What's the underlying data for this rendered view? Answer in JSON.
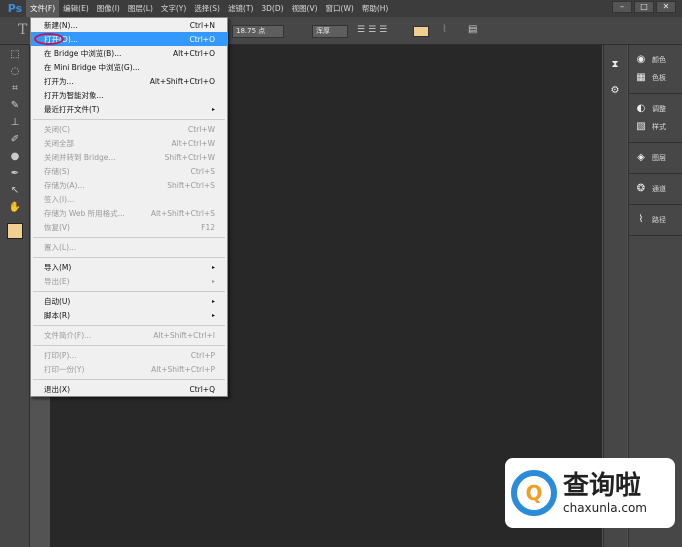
{
  "app": {
    "logo": "Ps"
  },
  "menubar": [
    "文件(F)",
    "编辑(E)",
    "图像(I)",
    "图层(L)",
    "文字(Y)",
    "选择(S)",
    "滤镜(T)",
    "3D(D)",
    "视图(V)",
    "窗口(W)",
    "帮助(H)"
  ],
  "window_buttons": [
    "–",
    "□",
    "✕"
  ],
  "options": {
    "tool_glyph": "T",
    "font_size": "18.75 点",
    "aa": "浑厚",
    "swatch_color": "#f0d090"
  },
  "file_menu": [
    {
      "label": "新建(N)...",
      "shortcut": "Ctrl+N"
    },
    {
      "label": "打开(O)...",
      "shortcut": "Ctrl+O",
      "highlight": true
    },
    {
      "label": "在 Bridge 中浏览(B)...",
      "shortcut": "Alt+Ctrl+O"
    },
    {
      "label": "在 Mini Bridge 中浏览(G)...",
      "shortcut": ""
    },
    {
      "label": "打开为...",
      "shortcut": "Alt+Shift+Ctrl+O"
    },
    {
      "label": "打开为智能对象...",
      "shortcut": ""
    },
    {
      "label": "最近打开文件(T)",
      "shortcut": "",
      "submenu": true
    },
    {
      "sep": true
    },
    {
      "label": "关闭(C)",
      "shortcut": "Ctrl+W",
      "disabled": true
    },
    {
      "label": "关闭全部",
      "shortcut": "Alt+Ctrl+W",
      "disabled": true
    },
    {
      "label": "关闭并转到 Bridge...",
      "shortcut": "Shift+Ctrl+W",
      "disabled": true
    },
    {
      "label": "存储(S)",
      "shortcut": "Ctrl+S",
      "disabled": true
    },
    {
      "label": "存储为(A)...",
      "shortcut": "Shift+Ctrl+S",
      "disabled": true
    },
    {
      "label": "签入(I)...",
      "shortcut": "",
      "disabled": true
    },
    {
      "label": "存储为 Web 所用格式...",
      "shortcut": "Alt+Shift+Ctrl+S",
      "disabled": true
    },
    {
      "label": "恢复(V)",
      "shortcut": "F12",
      "disabled": true
    },
    {
      "sep": true
    },
    {
      "label": "置入(L)...",
      "shortcut": "",
      "disabled": true
    },
    {
      "sep": true
    },
    {
      "label": "导入(M)",
      "shortcut": "",
      "submenu": true
    },
    {
      "label": "导出(E)",
      "shortcut": "",
      "submenu": true,
      "disabled": true
    },
    {
      "sep": true
    },
    {
      "label": "自动(U)",
      "shortcut": "",
      "submenu": true
    },
    {
      "label": "脚本(R)",
      "shortcut": "",
      "submenu": true
    },
    {
      "sep": true
    },
    {
      "label": "文件简介(F)...",
      "shortcut": "Alt+Shift+Ctrl+I",
      "disabled": true
    },
    {
      "sep": true
    },
    {
      "label": "打印(P)...",
      "shortcut": "Ctrl+P",
      "disabled": true
    },
    {
      "label": "打印一份(Y)",
      "shortcut": "Alt+Shift+Ctrl+P",
      "disabled": true
    },
    {
      "sep": true
    },
    {
      "label": "退出(X)",
      "shortcut": "Ctrl+Q"
    }
  ],
  "panels": [
    {
      "group": [
        {
          "icon": "color-icon",
          "glyph": "◉",
          "label": "颜色"
        },
        {
          "icon": "swatches-icon",
          "glyph": "▦",
          "label": "色板"
        }
      ]
    },
    {
      "group": [
        {
          "icon": "adjustments-icon",
          "glyph": "◐",
          "label": "调整"
        },
        {
          "icon": "styles-icon",
          "glyph": "▧",
          "label": "样式"
        }
      ]
    },
    {
      "group": [
        {
          "icon": "layers-icon",
          "glyph": "◈",
          "label": "图层"
        }
      ]
    },
    {
      "group": [
        {
          "icon": "channels-icon",
          "glyph": "❂",
          "label": "通道"
        }
      ]
    },
    {
      "group": [
        {
          "icon": "paths-icon",
          "glyph": "⌇",
          "label": "路径"
        }
      ]
    }
  ],
  "tools": [
    "⬚",
    "◌",
    "⌗",
    "✎",
    "⊥",
    "✐",
    "●",
    "✒",
    "↖",
    "✋"
  ],
  "watermark": {
    "logo_letter": "Q",
    "title": "查询啦",
    "url": "chaxunla.com"
  }
}
